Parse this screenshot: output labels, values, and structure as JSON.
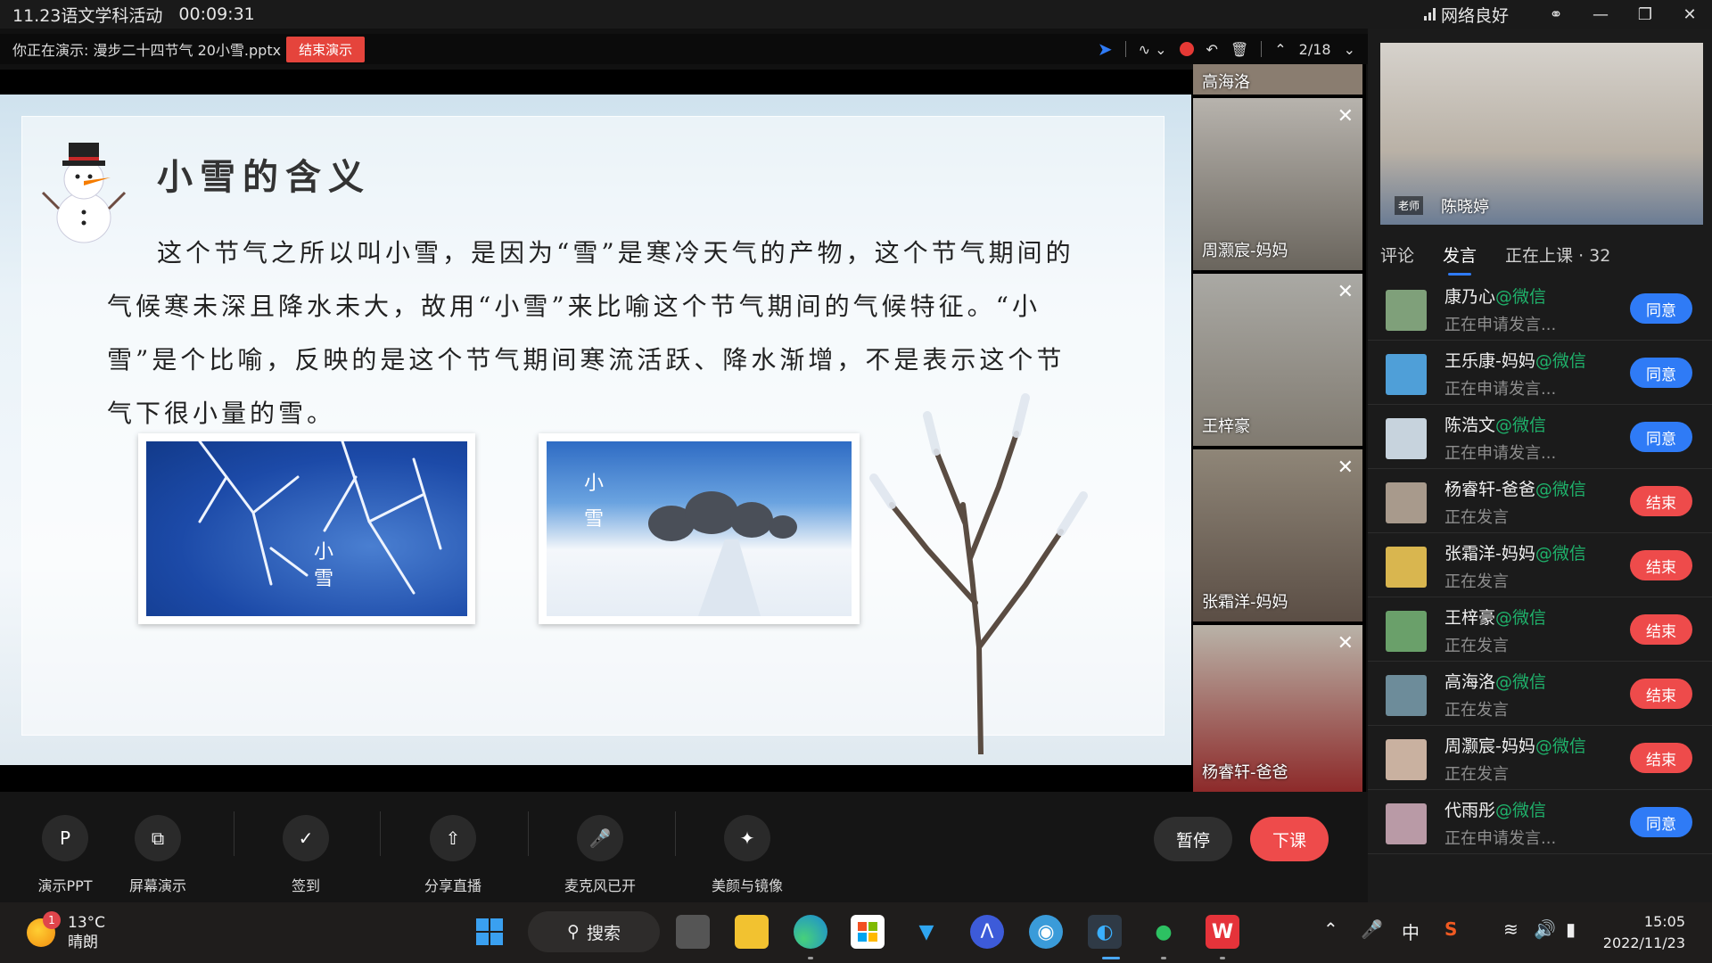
{
  "window": {
    "title": "11.23语文学科活动",
    "timer": "00:09:31",
    "network": "网络良好"
  },
  "presenting": {
    "label": "你正在演示: 漫步二十四节气 20小雪.pptx",
    "end_button": "结束演示",
    "page_indicator": "2/18"
  },
  "slide": {
    "title": "小雪的含义",
    "body": "这个节气之所以叫小雪，是因为“雪”是寒冷天气的产物，这个节气期间的气候寒未深且降水未大，故用“小雪”来比喻这个节气期间的气候特征。“小雪”是个比喻，反映的是这个节气期间寒流活跃、降水渐增，不是表示这个节气下很小量的雪。",
    "photo1_caption": "小雪",
    "photo2_caption": "小雪"
  },
  "videos": [
    {
      "name": "高海洛"
    },
    {
      "name": "周灏宸-妈妈"
    },
    {
      "name": "王梓豪"
    },
    {
      "name": "张霜洋-妈妈"
    },
    {
      "name": "杨睿轩-爸爸"
    }
  ],
  "teacher": {
    "tag": "老师",
    "name": "陈晓婷"
  },
  "tabs": [
    "评论",
    "发言",
    "正在上课 · 32"
  ],
  "participants": [
    {
      "name": "康乃心",
      "source": "@微信",
      "status": "正在申请发言...",
      "action": "同意",
      "color": "#2f7bf6"
    },
    {
      "name": "王乐康-妈妈",
      "source": "@微信",
      "status": "正在申请发言...",
      "action": "同意",
      "color": "#2f7bf6"
    },
    {
      "name": "陈浩文",
      "source": "@微信",
      "status": "正在申请发言...",
      "action": "同意",
      "color": "#2f7bf6"
    },
    {
      "name": "杨睿轩-爸爸",
      "source": "@微信",
      "status": "正在发言",
      "action": "结束",
      "color": "#ee4b4b"
    },
    {
      "name": "张霜洋-妈妈",
      "source": "@微信",
      "status": "正在发言",
      "action": "结束",
      "color": "#ee4b4b"
    },
    {
      "name": "王梓豪",
      "source": "@微信",
      "status": "正在发言",
      "action": "结束",
      "color": "#ee4b4b"
    },
    {
      "name": "高海洛",
      "source": "@微信",
      "status": "正在发言",
      "action": "结束",
      "color": "#ee4b4b"
    },
    {
      "name": "周灏宸-妈妈",
      "source": "@微信",
      "status": "正在发言",
      "action": "结束",
      "color": "#ee4b4b"
    },
    {
      "name": "代雨彤",
      "source": "@微信",
      "status": "正在申请发言...",
      "action": "同意",
      "color": "#2f7bf6"
    }
  ],
  "controls": {
    "present_ppt": "演示PPT",
    "screen_share": "屏幕演示",
    "checkin": "签到",
    "share_live": "分享直播",
    "mic": "麦克风已开",
    "beauty": "美颜与镜像",
    "pause": "暂停",
    "end_class": "下课"
  },
  "taskbar": {
    "weather_temp": "13°C",
    "weather_desc": "晴朗",
    "weather_badge": "1",
    "search": "搜索",
    "ime": "中",
    "time": "15:05",
    "date": "2022/11/23"
  }
}
